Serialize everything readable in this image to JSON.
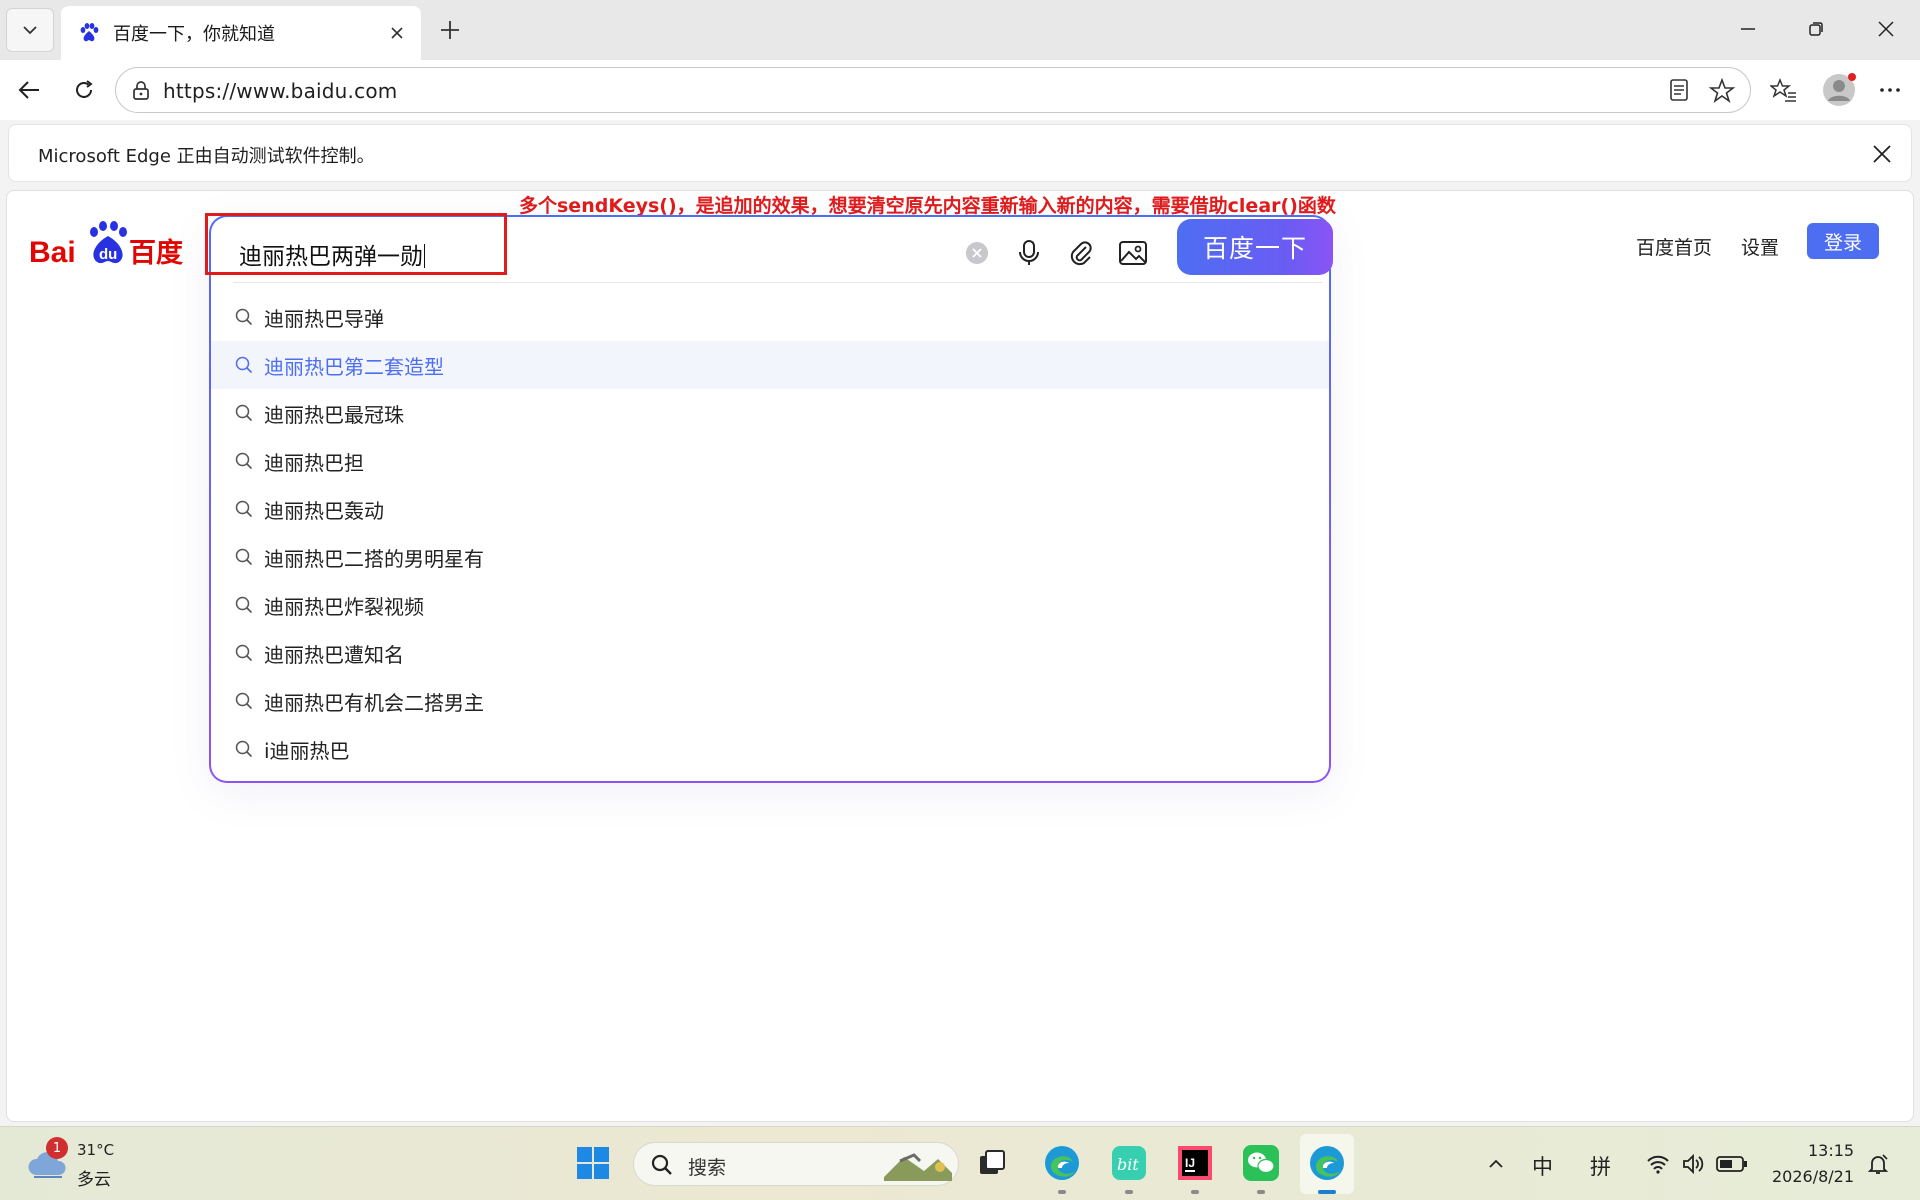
{
  "browser": {
    "tab_title": "百度一下，你就知道",
    "url": "https://www.baidu.com",
    "infobar_text": "Microsoft Edge 正由自动测试软件控制。"
  },
  "page": {
    "annotation": "多个sendKeys()，是追加的效果，想要清空原先内容重新输入新的内容，需要借助clear()函数",
    "logo_text": {
      "part1": "Bai",
      "part2": "du",
      "part3": "百度"
    },
    "search_value": "迪丽热巴两弹一勋",
    "search_button": "百度一下",
    "suggestions": [
      "迪丽热巴导弹",
      "迪丽热巴第二套造型",
      "迪丽热巴最冠珠",
      "迪丽热巴担",
      "迪丽热巴轰动",
      "迪丽热巴二搭的男明星有",
      "迪丽热巴炸裂视频",
      "迪丽热巴遭知名",
      "迪丽热巴有机会二搭男主",
      "i迪丽热巴"
    ],
    "highlighted_index": 1,
    "nav": {
      "home": "百度首页",
      "settings": "设置",
      "login": "登录"
    },
    "accent_color": "#4e6ef2"
  },
  "taskbar": {
    "weather_temp": "31°C",
    "weather_desc": "多云",
    "weather_badge": "1",
    "search_label": "搜索",
    "ime_lang": "中",
    "ime_mode": "拼",
    "time": "13:15",
    "date": "2026/8/21"
  }
}
